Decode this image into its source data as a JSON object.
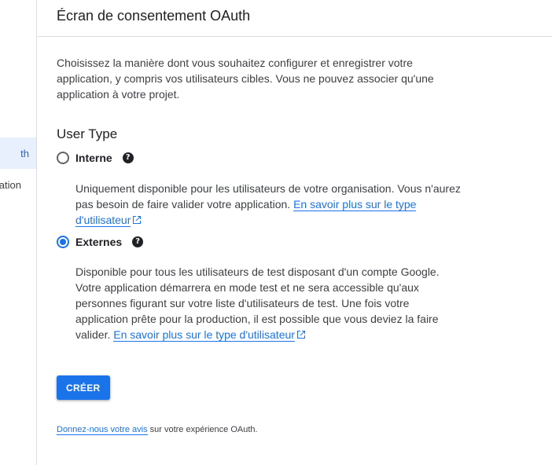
{
  "sidebar": {
    "items": [
      {
        "label": "OAuth",
        "visible": "th",
        "active": true
      },
      {
        "label": "Validation",
        "visible": "ation",
        "active": false
      }
    ]
  },
  "header": {
    "title": "Écran de consentement OAuth"
  },
  "main": {
    "intro": "Choisissez la manière dont vous souhaitez configurer et enregistrer votre application, y compris vos utilisateurs cibles. Vous ne pouvez associer qu'une application à votre projet.",
    "section_title": "User Type",
    "options": [
      {
        "label": "Interne",
        "selected": false,
        "description": "Uniquement disponible pour les utilisateurs de votre organisation. Vous n'aurez pas besoin de faire valider votre application. ",
        "link_text": "En savoir plus sur le type d'utilisateur"
      },
      {
        "label": "Externes",
        "selected": true,
        "description": "Disponible pour tous les utilisateurs de test disposant d'un compte Google. Votre application démarrera en mode test et ne sera accessible qu'aux personnes figurant sur votre liste d'utilisateurs de test. Une fois votre application prête pour la production, il est possible que vous deviez la faire valider. ",
        "link_text": "En savoir plus sur le type d'utilisateur"
      }
    ],
    "help_icon": "?",
    "create_label": "CRÉER",
    "feedback": {
      "link_text": "Donnez-nous votre avis",
      "suffix": " sur votre expérience OAuth."
    }
  },
  "colors": {
    "accent": "#1a73e8",
    "active_nav_bg": "#e8f0fe",
    "divider": "#dadce0"
  }
}
